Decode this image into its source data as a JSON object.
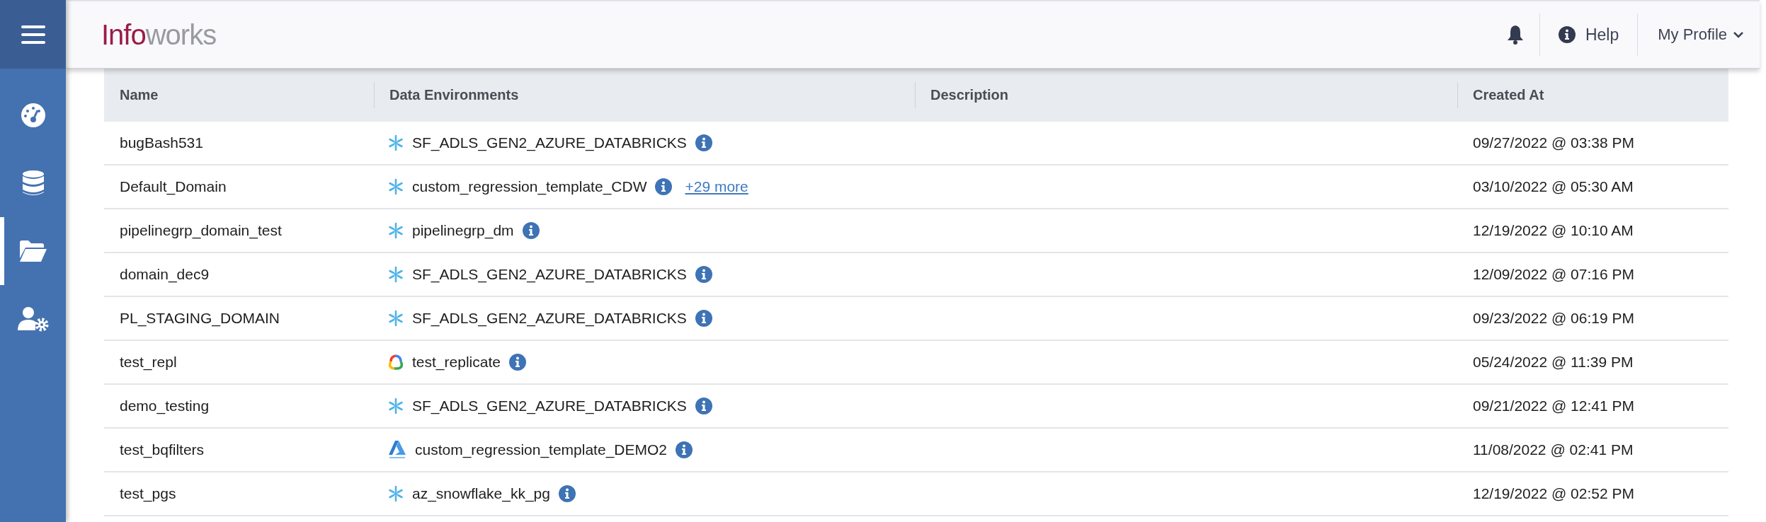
{
  "sidebar": {
    "items": [
      {
        "kind": "dashboard",
        "selected": false
      },
      {
        "kind": "database",
        "selected": false
      },
      {
        "kind": "folder",
        "selected": true
      },
      {
        "kind": "admin",
        "selected": false
      }
    ]
  },
  "header": {
    "logo": {
      "brand_first": "Info",
      "brand_second": "works"
    },
    "help": "Help",
    "profile": "My Profile"
  },
  "table": {
    "columns": [
      "Name",
      "Data Environments",
      "Description",
      "Created At"
    ],
    "rows": [
      {
        "name": "bugBash531",
        "environment": {
          "kind": "snowflake",
          "label": "SF_ADLS_GEN2_AZURE_DATABRICKS"
        },
        "created_at": "09/27/2022 @ 03:38 PM"
      },
      {
        "name": "Default_Domain",
        "environment": {
          "kind": "snowflake",
          "label": "custom_regression_template_CDW"
        },
        "more": "+29 more",
        "created_at": "03/10/2022 @ 05:30 AM"
      },
      {
        "name": "pipelinegrp_domain_test",
        "environment": {
          "kind": "snowflake",
          "label": "pipelinegrp_dm"
        },
        "created_at": "12/19/2022 @ 10:10 AM"
      },
      {
        "name": "domain_dec9",
        "environment": {
          "kind": "snowflake",
          "label": "SF_ADLS_GEN2_AZURE_DATABRICKS"
        },
        "created_at": "12/09/2022 @ 07:16 PM"
      },
      {
        "name": "PL_STAGING_DOMAIN",
        "environment": {
          "kind": "snowflake",
          "label": "SF_ADLS_GEN2_AZURE_DATABRICKS"
        },
        "created_at": "09/23/2022 @ 06:19 PM"
      },
      {
        "name": "test_repl",
        "environment": {
          "kind": "gcp",
          "label": "test_replicate"
        },
        "created_at": "05/24/2022 @ 11:39 PM"
      },
      {
        "name": "demo_testing",
        "environment": {
          "kind": "snowflake",
          "label": "SF_ADLS_GEN2_AZURE_DATABRICKS"
        },
        "created_at": "09/21/2022 @ 12:41 PM"
      },
      {
        "name": "test_bqfilters",
        "environment": {
          "kind": "azure",
          "label": "custom_regression_template_DEMO2"
        },
        "created_at": "11/08/2022 @ 02:41 PM"
      },
      {
        "name": "test_pgs",
        "environment": {
          "kind": "snowflake",
          "label": "az_snowflake_kk_pg"
        },
        "created_at": "12/19/2022 @ 02:52 PM"
      }
    ]
  }
}
